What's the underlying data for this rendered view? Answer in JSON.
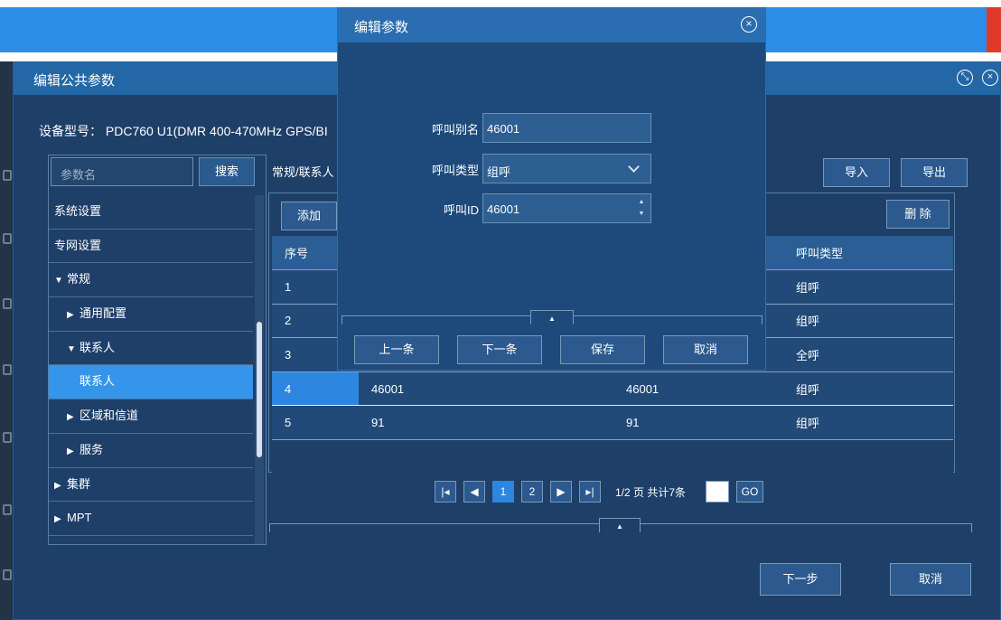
{
  "window": {
    "title": "编辑公共参数"
  },
  "device_label": "设备型号： PDC760 U1(DMR 400-470MHz GPS/BI",
  "search": {
    "placeholder": "参数名",
    "button": "搜索"
  },
  "tree": [
    {
      "label": "系统设置",
      "indent": 0,
      "caret": ""
    },
    {
      "label": "专网设置",
      "indent": 0,
      "caret": ""
    },
    {
      "label": "常规",
      "indent": 0,
      "caret": "▼"
    },
    {
      "label": "通用配置",
      "indent": 1,
      "caret": "▶"
    },
    {
      "label": "联系人",
      "indent": 1,
      "caret": "▼"
    },
    {
      "label": "联系人",
      "indent": 2,
      "caret": "",
      "selected": true
    },
    {
      "label": "区域和信道",
      "indent": 1,
      "caret": "▶"
    },
    {
      "label": "服务",
      "indent": 1,
      "caret": "▶"
    },
    {
      "label": "集群",
      "indent": 0,
      "caret": "▶"
    },
    {
      "label": "MPT",
      "indent": 0,
      "caret": "▶"
    }
  ],
  "breadcrumb": "常规/联系人",
  "toolbar": {
    "import": "导入",
    "export": "导出",
    "add": "添加",
    "delete": "删 除"
  },
  "table": {
    "headers": [
      "序号",
      "",
      "",
      "呼叫类型"
    ],
    "rows": [
      [
        "1",
        "",
        "",
        "组呼"
      ],
      [
        "2",
        "",
        "",
        "组呼"
      ],
      [
        "3",
        "",
        "",
        "全呼"
      ],
      [
        "4",
        "46001",
        "46001",
        "组呼"
      ],
      [
        "5",
        "91",
        "91",
        "组呼"
      ]
    ],
    "highlighted_row": 3
  },
  "pager": {
    "first": "⏮",
    "prev": "◀",
    "pages": [
      "1",
      "2"
    ],
    "current": "1",
    "next": "▶",
    "last": "⏭",
    "info": "1/2 页 共计7条",
    "go": "GO"
  },
  "footer": {
    "next": "下一步",
    "cancel": "取消"
  },
  "dialog": {
    "title": "编辑参数",
    "alias_label": "呼叫别名",
    "alias_value": "46001",
    "type_label": "呼叫类型",
    "type_value": "组呼",
    "id_label": "呼叫ID",
    "id_value": "46001",
    "buttons": {
      "prev": "上一条",
      "next": "下一条",
      "save": "保存",
      "cancel": "取消"
    }
  },
  "colors": {
    "window_bg": "#1e3f68",
    "title_bar": "#2467a6",
    "selected": "#3495ea",
    "dialog_bg": "#1d4a7a"
  }
}
